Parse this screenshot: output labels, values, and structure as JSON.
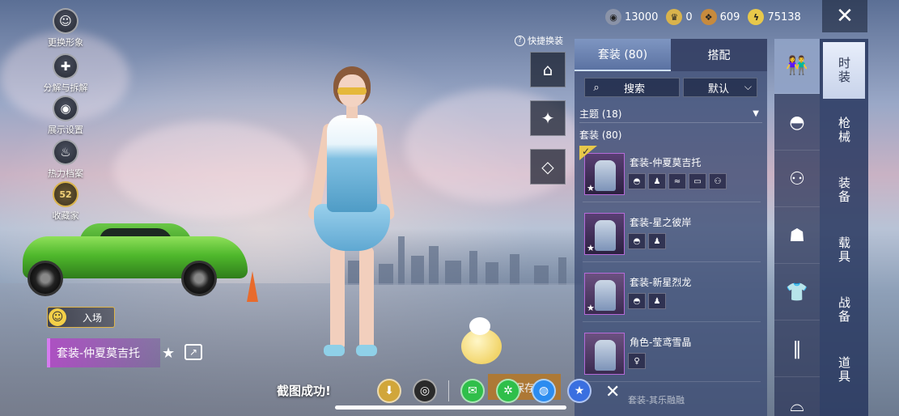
{
  "currencies": [
    {
      "icon": "silver-coin-icon",
      "value": "13000",
      "color": "#8a93a8"
    },
    {
      "icon": "gold-crown-coin-icon",
      "value": "0",
      "color": "#d9b34c"
    },
    {
      "icon": "bp-coin-icon",
      "value": "609",
      "color": "#c78a3d"
    },
    {
      "icon": "lightning-coin-icon",
      "value": "75138",
      "color": "#e8c84a"
    }
  ],
  "left_menu": [
    {
      "name": "change-appearance",
      "icon": "avatar-icon",
      "glyph": "☺",
      "label": "更换形象"
    },
    {
      "name": "decompose",
      "icon": "puzzle-icon",
      "glyph": "✚",
      "label": "分解与拆解"
    },
    {
      "name": "display-settings",
      "icon": "eye-icon",
      "glyph": "◉",
      "label": "展示设置"
    },
    {
      "name": "heat-archive",
      "icon": "flame-icon",
      "glyph": "♨",
      "label": "热力档案"
    },
    {
      "name": "collector",
      "icon": "level-badge-icon",
      "glyph": "52",
      "label": "收藏家"
    }
  ],
  "entry": {
    "label": "入场"
  },
  "current_suit": "套装-仲夏莫吉托",
  "quick_change": {
    "label": "快捷换装",
    "help": "?"
  },
  "quick_buttons": [
    {
      "name": "wardrobe-button",
      "icon": "hanger-icon",
      "glyph": "⌂"
    },
    {
      "name": "outfit-preview-button",
      "icon": "outfit-icon",
      "glyph": "✦"
    },
    {
      "name": "diamond-button",
      "icon": "diamond-icon",
      "glyph": "◇"
    }
  ],
  "panel": {
    "tabs": [
      {
        "label": "套装 (80)",
        "active": true
      },
      {
        "label": "搭配",
        "active": false
      }
    ],
    "search_placeholder": "搜索",
    "sort_label": "默认",
    "theme_label": "主题 (18)",
    "suits_label": "套装 (80)",
    "items": [
      {
        "name": "套装-仲夏莫吉托",
        "equipped": true,
        "sub_count": 5
      },
      {
        "name": "套装-星之彼岸",
        "equipped": false,
        "sub_count": 2
      },
      {
        "name": "套装-新星烈龙",
        "equipped": false,
        "sub_count": 2
      },
      {
        "name": "角色-莹鸢雪晶",
        "equipped": false,
        "sub_count": 1
      }
    ],
    "peek_item": "套装-其乐融融"
  },
  "categories": [
    {
      "icon": "suit-icon",
      "glyph": "👫",
      "active": true
    },
    {
      "icon": "hat-icon",
      "glyph": "◓",
      "active": false
    },
    {
      "icon": "glasses-icon",
      "glyph": "⚇",
      "active": false
    },
    {
      "icon": "mask-icon",
      "glyph": "☗",
      "active": false
    },
    {
      "icon": "top-icon",
      "glyph": "👕",
      "active": false
    },
    {
      "icon": "pants-icon",
      "glyph": "‖",
      "active": false
    },
    {
      "icon": "shoes-icon",
      "glyph": "⌓",
      "active": false
    }
  ],
  "side_tabs": [
    {
      "label": "时装",
      "active": true
    },
    {
      "label": "枪械",
      "active": false
    },
    {
      "label": "装备",
      "active": false
    },
    {
      "label": "载具",
      "active": false
    },
    {
      "label": "战备",
      "active": false
    },
    {
      "label": "道具",
      "active": false
    }
  ],
  "toast": {
    "message": "截图成功!",
    "save_label": "保存",
    "share_targets": [
      "download-icon",
      "app-icon",
      "wechat-icon",
      "moments-icon",
      "qq-icon",
      "qzone-icon"
    ]
  }
}
